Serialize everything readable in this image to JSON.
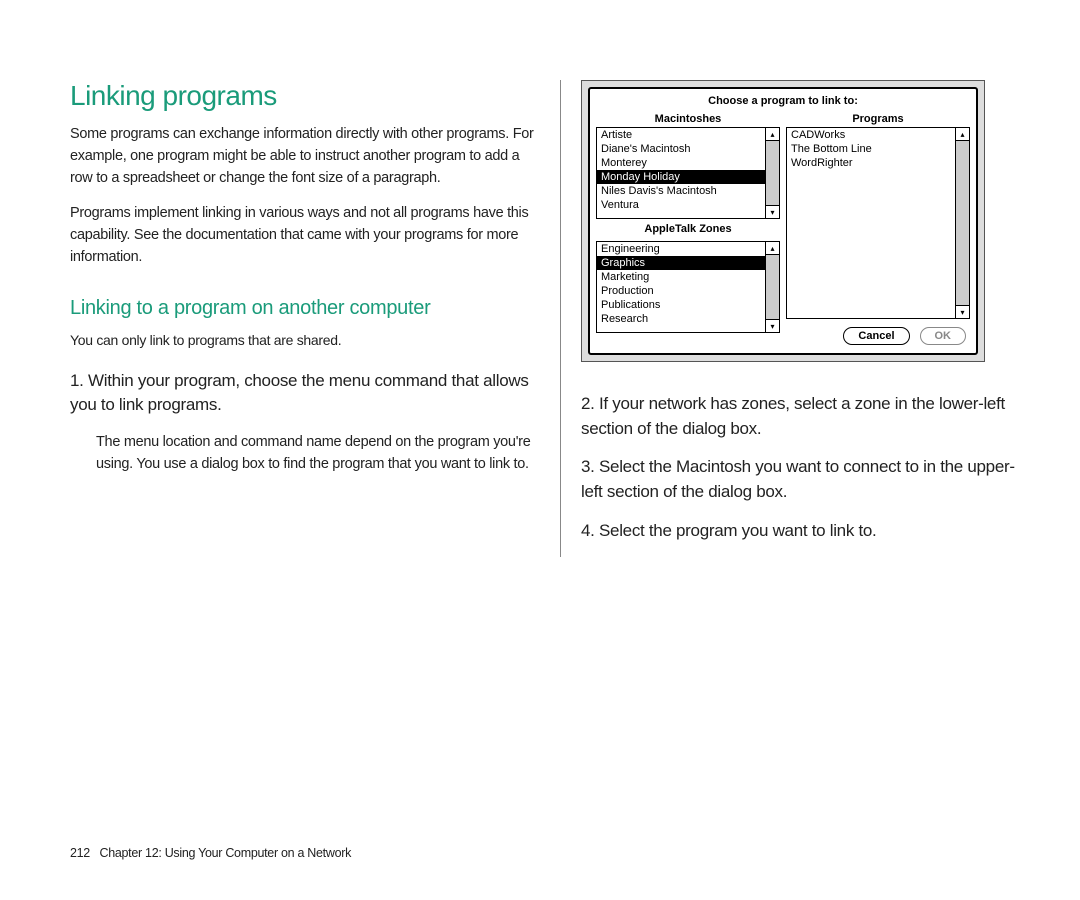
{
  "headings": {
    "h1": "Linking programs",
    "h2": "Linking to a program on another computer"
  },
  "paragraphs": {
    "intro1": "Some programs can exchange information directly with other programs. For example, one program might be able to instruct another program to add a row to a spreadsheet or change the font size of a paragraph.",
    "intro2": "Programs implement linking in various ways and not all programs have this capability. See the documentation that came with your programs for more information.",
    "note": "You can only link to programs that are shared.",
    "step1": "1.  Within your program, choose the menu command that allows you to link programs.",
    "step1sub": "The menu location and command name depend on the program you're using. You use a dialog box to find the program that you want to link to.",
    "step2": "2.  If your network has zones, select a zone in the lower-left section of the dialog box.",
    "step3": "3.  Select the Macintosh you want to connect to in the upper-left section of the dialog box.",
    "step4": "4.  Select the program you want to link to."
  },
  "dialog": {
    "title": "Choose a program to link to:",
    "macintoshes_label": "Macintoshes",
    "programs_label": "Programs",
    "zones_label": "AppleTalk Zones",
    "macintoshes": [
      "Artiste",
      "Diane's Macintosh",
      "Monterey",
      "Monday Holiday",
      "Niles Davis's Macintosh",
      "Ventura"
    ],
    "mac_selected_index": 3,
    "programs": [
      "CADWorks",
      "The Bottom Line",
      "WordRighter"
    ],
    "zones": [
      "Engineering",
      "Graphics",
      "Marketing",
      "Production",
      "Publications",
      "Research"
    ],
    "zone_selected_index": 1,
    "cancel": "Cancel",
    "ok": "OK"
  },
  "footer": {
    "page": "212",
    "chapter": "Chapter 12: Using Your Computer on a Network"
  }
}
